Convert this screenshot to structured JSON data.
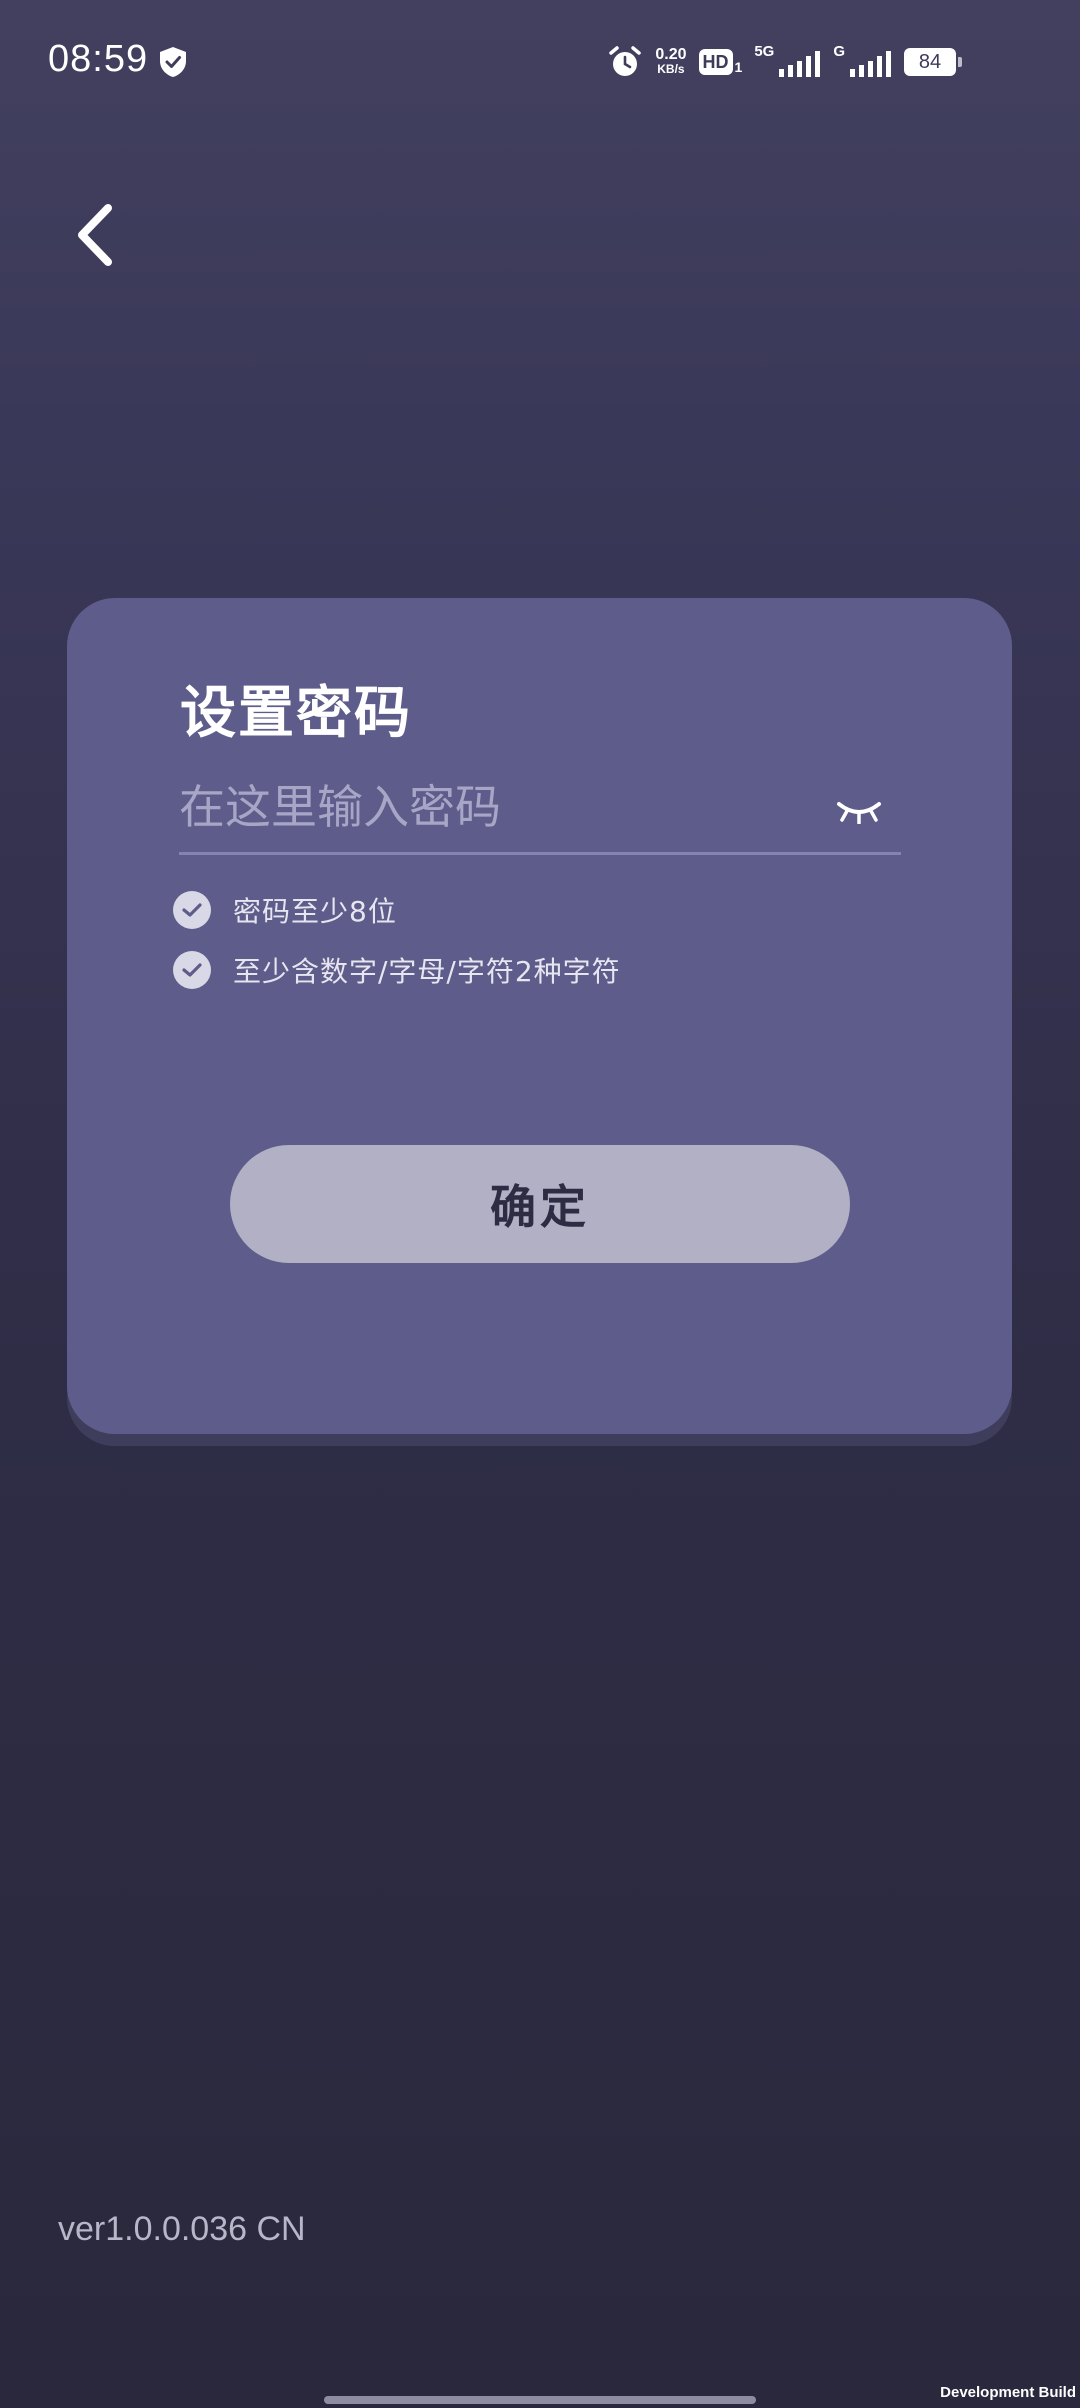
{
  "status_bar": {
    "time": "08:59",
    "net_speed_value": "0.20",
    "net_speed_unit": "KB/s",
    "hd_label": "HD",
    "hd_sub": "1",
    "signal1_label": "5G",
    "signal2_label": "G",
    "battery_level": "84"
  },
  "form": {
    "title": "设置密码",
    "password_placeholder": "在这里输入密码",
    "password_value": "",
    "rules": [
      {
        "text": "密码至少8位",
        "checked": true
      },
      {
        "text": "至少含数字/字母/字符2种字符",
        "checked": true
      }
    ],
    "confirm_label": "确定"
  },
  "footer": {
    "version": "ver1.0.0.036 CN",
    "build_label": "Development Build"
  },
  "colors": {
    "card": "#5d5c8a",
    "button": "#b2b0c5",
    "background_top": "#43405f",
    "background_bottom": "#29283c"
  }
}
